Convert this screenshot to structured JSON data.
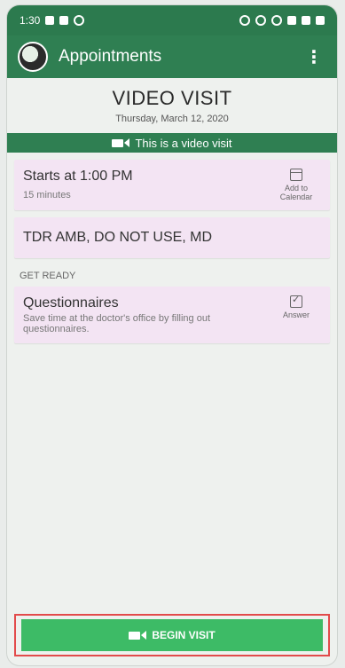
{
  "status_bar": {
    "time": "1:30"
  },
  "app_bar": {
    "title": "Appointments",
    "menu_icon": "kebab-menu-icon"
  },
  "visit": {
    "title": "VIDEO VISIT",
    "date": "Thursday, March 12, 2020"
  },
  "banner": {
    "text": "This is a video visit"
  },
  "time_card": {
    "starts": "Starts at 1:00 PM",
    "duration": "15 minutes",
    "action_label_line1": "Add to",
    "action_label_line2": "Calendar"
  },
  "provider_card": {
    "name": "TDR AMB, DO NOT USE, MD"
  },
  "section": {
    "get_ready": "GET READY"
  },
  "questionnaire_card": {
    "title": "Questionnaires",
    "description": "Save time at the doctor's office by filling out questionnaires.",
    "action_label": "Answer"
  },
  "begin_button": {
    "label": "BEGIN VISIT"
  },
  "colors": {
    "primary_green": "#2f7f52",
    "button_green": "#3dbb66",
    "card_bg": "#f3e4f3",
    "highlight_red": "#e24b4b"
  }
}
